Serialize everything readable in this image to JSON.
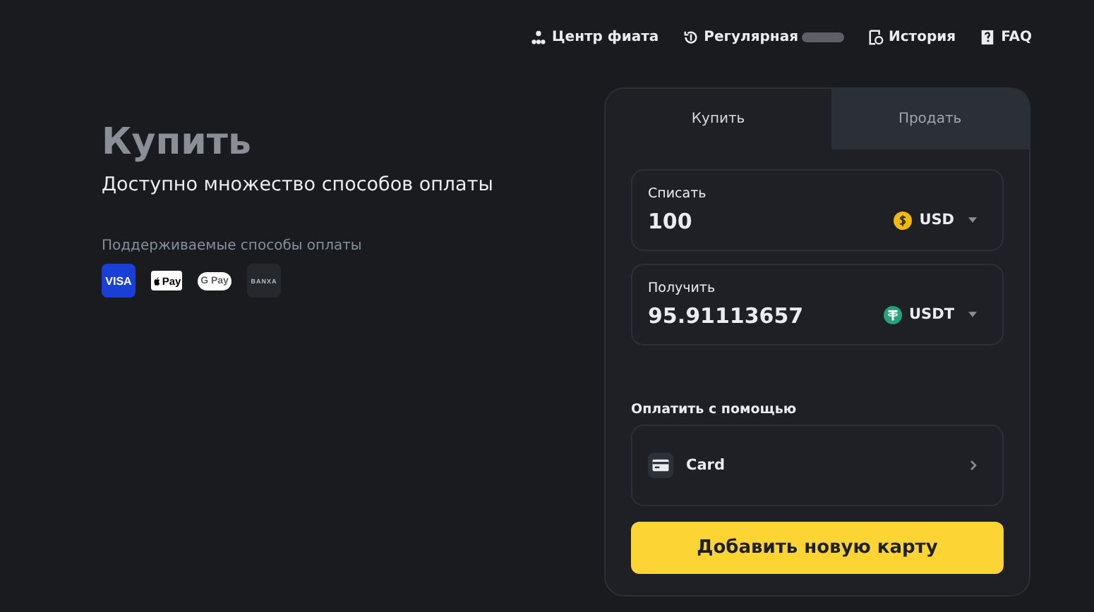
{
  "nav": [
    {
      "kind": "people",
      "label": "Центр фиата"
    },
    {
      "kind": "recurring",
      "label": "Регулярная",
      "redacted": true
    },
    {
      "kind": "history",
      "label": "История"
    },
    {
      "kind": "faq",
      "label": "FAQ"
    }
  ],
  "hero": {
    "title": "Купить",
    "subtitle": "Доступно множество способов оплаты",
    "methods_label": "Поддерживаемые способы оплаты",
    "methods": [
      {
        "kind": "visa",
        "label": "VISA"
      },
      {
        "kind": "applepay",
        "label": "Pay"
      },
      {
        "kind": "gpay",
        "label": "G Pay"
      },
      {
        "kind": "banxa",
        "label": "BANXA"
      }
    ]
  },
  "tabs": [
    {
      "label": "Купить",
      "selected": true
    },
    {
      "label": "Продать",
      "selected": false
    }
  ],
  "fields": [
    {
      "label": "Списать",
      "value": "100",
      "currency": "USD",
      "kind": "dollar"
    },
    {
      "label": "Получить",
      "value": "95.91113657",
      "currency": "USDT",
      "kind": "tether"
    }
  ],
  "pay_with": {
    "label": "Оплатить с помощью",
    "method": "Card"
  },
  "button": "Добавить новую карту"
}
